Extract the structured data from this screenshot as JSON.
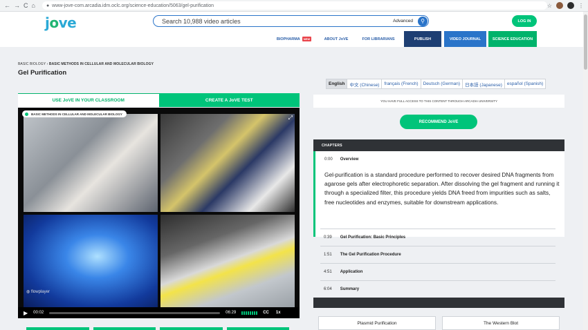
{
  "browser": {
    "url": "www-jove-com.arcadia.idm.oclc.org/science-education/5063/gel-purification",
    "back_glyph": "←",
    "forward_glyph": "→",
    "reload_glyph": "C",
    "home_glyph": "⌂",
    "lock_glyph": "●",
    "star_glyph": "☆",
    "menu_glyph": "⋮"
  },
  "header": {
    "logo_j": "j",
    "logo_o": "o",
    "logo_rest": "ve",
    "search_placeholder": "Search 10,988 video articles",
    "advanced_label": "Advanced",
    "search_glyph": "⚲",
    "login_label": "LOG IN",
    "nav": [
      {
        "label": "BIOPHARMA",
        "badge": "NEW"
      },
      {
        "label": "ABOUT JoVE"
      },
      {
        "label": "FOR LIBRARIANS"
      },
      {
        "label": "PUBLISH",
        "bg": "#1e3f73"
      },
      {
        "label": "VIDEO JOURNAL",
        "bg": "#2a74c9"
      },
      {
        "label": "SCIENCE EDUCATION",
        "bg": "#00b36b"
      }
    ]
  },
  "breadcrumb": {
    "first": "BASIC BIOLOGY",
    "sep": " › ",
    "second": "BASIC METHODS IN CELLULAR AND MOLECULAR BIOLOGY"
  },
  "page_title": "Gel Purification",
  "tabs": {
    "classroom": "USE JoVE IN YOUR CLASSROOM",
    "test": "CREATE A JoVE TEST"
  },
  "video": {
    "collection_label": "BASIC METHODS IN CELLULAR AND MOLECULAR BIOLOGY",
    "expand_glyph": "⤢",
    "player_brand": "◍ flowplayer",
    "play_glyph": "▶",
    "current_time": "00:02",
    "duration": "06:29",
    "cc_label": "CC",
    "speed_label": "1x",
    "progress": 0.005
  },
  "languages": [
    {
      "label": "English",
      "active": true
    },
    {
      "label": "中文 (Chinese)"
    },
    {
      "label": "français (French)"
    },
    {
      "label": "Deutsch (German)"
    },
    {
      "label": "日本語 (Japanese)"
    },
    {
      "label": "español (Spanish)"
    }
  ],
  "access_text": "YOU HAVE FULL ACCESS TO THIS CONTENT THROUGH ARCADIA UNIVERSITY",
  "recommend_label": "RECOMMEND JoVE",
  "chapters": {
    "heading": "CHAPTERS",
    "active": {
      "time": "0:00",
      "title": "Overview",
      "description": "Gel-purification is a standard procedure performed to recover desired DNA fragments from agarose gels after electrophoretic separation. After dissolving the gel fragment and running it through a specialized filter, this procedure yields DNA freed from impurities such as salts, free nucleotides and enzymes, suitable for downstream applications."
    },
    "items": [
      {
        "time": "0:39",
        "title": "Gel Purification: Basic Principles"
      },
      {
        "time": "1:51",
        "title": "The Gel Purification Procedure"
      },
      {
        "time": "4:51",
        "title": "Application"
      },
      {
        "time": "6:04",
        "title": "Summary"
      }
    ]
  },
  "related": [
    {
      "label": "Plasmid Purification"
    },
    {
      "label": "The Western Blot"
    }
  ]
}
